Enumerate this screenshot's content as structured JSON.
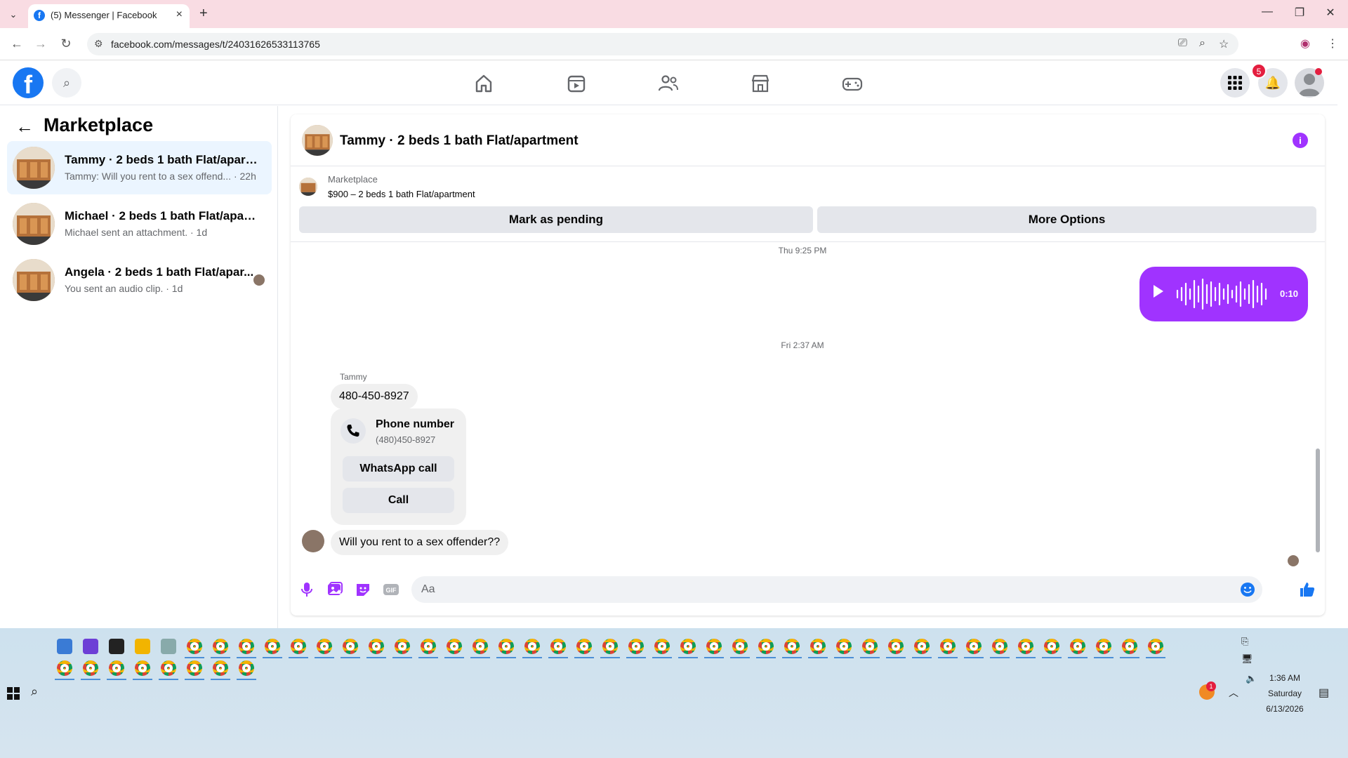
{
  "browser": {
    "tab_title": "(5) Messenger | Facebook",
    "url": "facebook.com/messages/t/24031626533113765"
  },
  "header": {
    "notification_count": "5",
    "nav_icons": [
      "home-icon",
      "watch-icon",
      "friends-icon",
      "marketplace-icon",
      "gaming-icon"
    ]
  },
  "sidebar": {
    "title": "Marketplace",
    "conversations": [
      {
        "name": "Tammy · 2 beds 1 bath Flat/apartm...",
        "snippet": "Tammy: Will you rent to a sex offend... · 22h",
        "active": true
      },
      {
        "name": "Michael · 2 beds 1 bath Flat/apart...",
        "snippet": "Michael sent an attachment. · 1d",
        "active": false
      },
      {
        "name": "Angela · 2 beds 1 bath Flat/apar...",
        "snippet": "You sent an audio clip. · 1d",
        "active": false
      }
    ]
  },
  "chat": {
    "title": "Tammy · 2 beds 1 bath Flat/apartment",
    "listing_label": "Marketplace",
    "listing_price": "$900 – 2 beds 1 bath Flat/apartment",
    "mark_pending": "Mark as pending",
    "more_options": "More Options",
    "timestamp1": "Thu 9:25 PM",
    "audio_duration": "0:10",
    "timestamp2": "Fri 2:37 AM",
    "sender": "Tammy",
    "msg1": "480-450-8927",
    "phone_card_title": "Phone number",
    "phone_card_number": "(480)450-8927",
    "whatsapp_call": "WhatsApp call",
    "call": "Call",
    "msg2": "Will you rent to a sex offender??",
    "composer_placeholder": "Aa"
  },
  "taskbar": {
    "time": "1:36 AM",
    "day": "Saturday",
    "date": "6/13/2026",
    "weather_badge": "1"
  },
  "colors": {
    "accent": "#a033ff",
    "fb_blue": "#1877f2",
    "active_row": "#ebf5ff"
  }
}
